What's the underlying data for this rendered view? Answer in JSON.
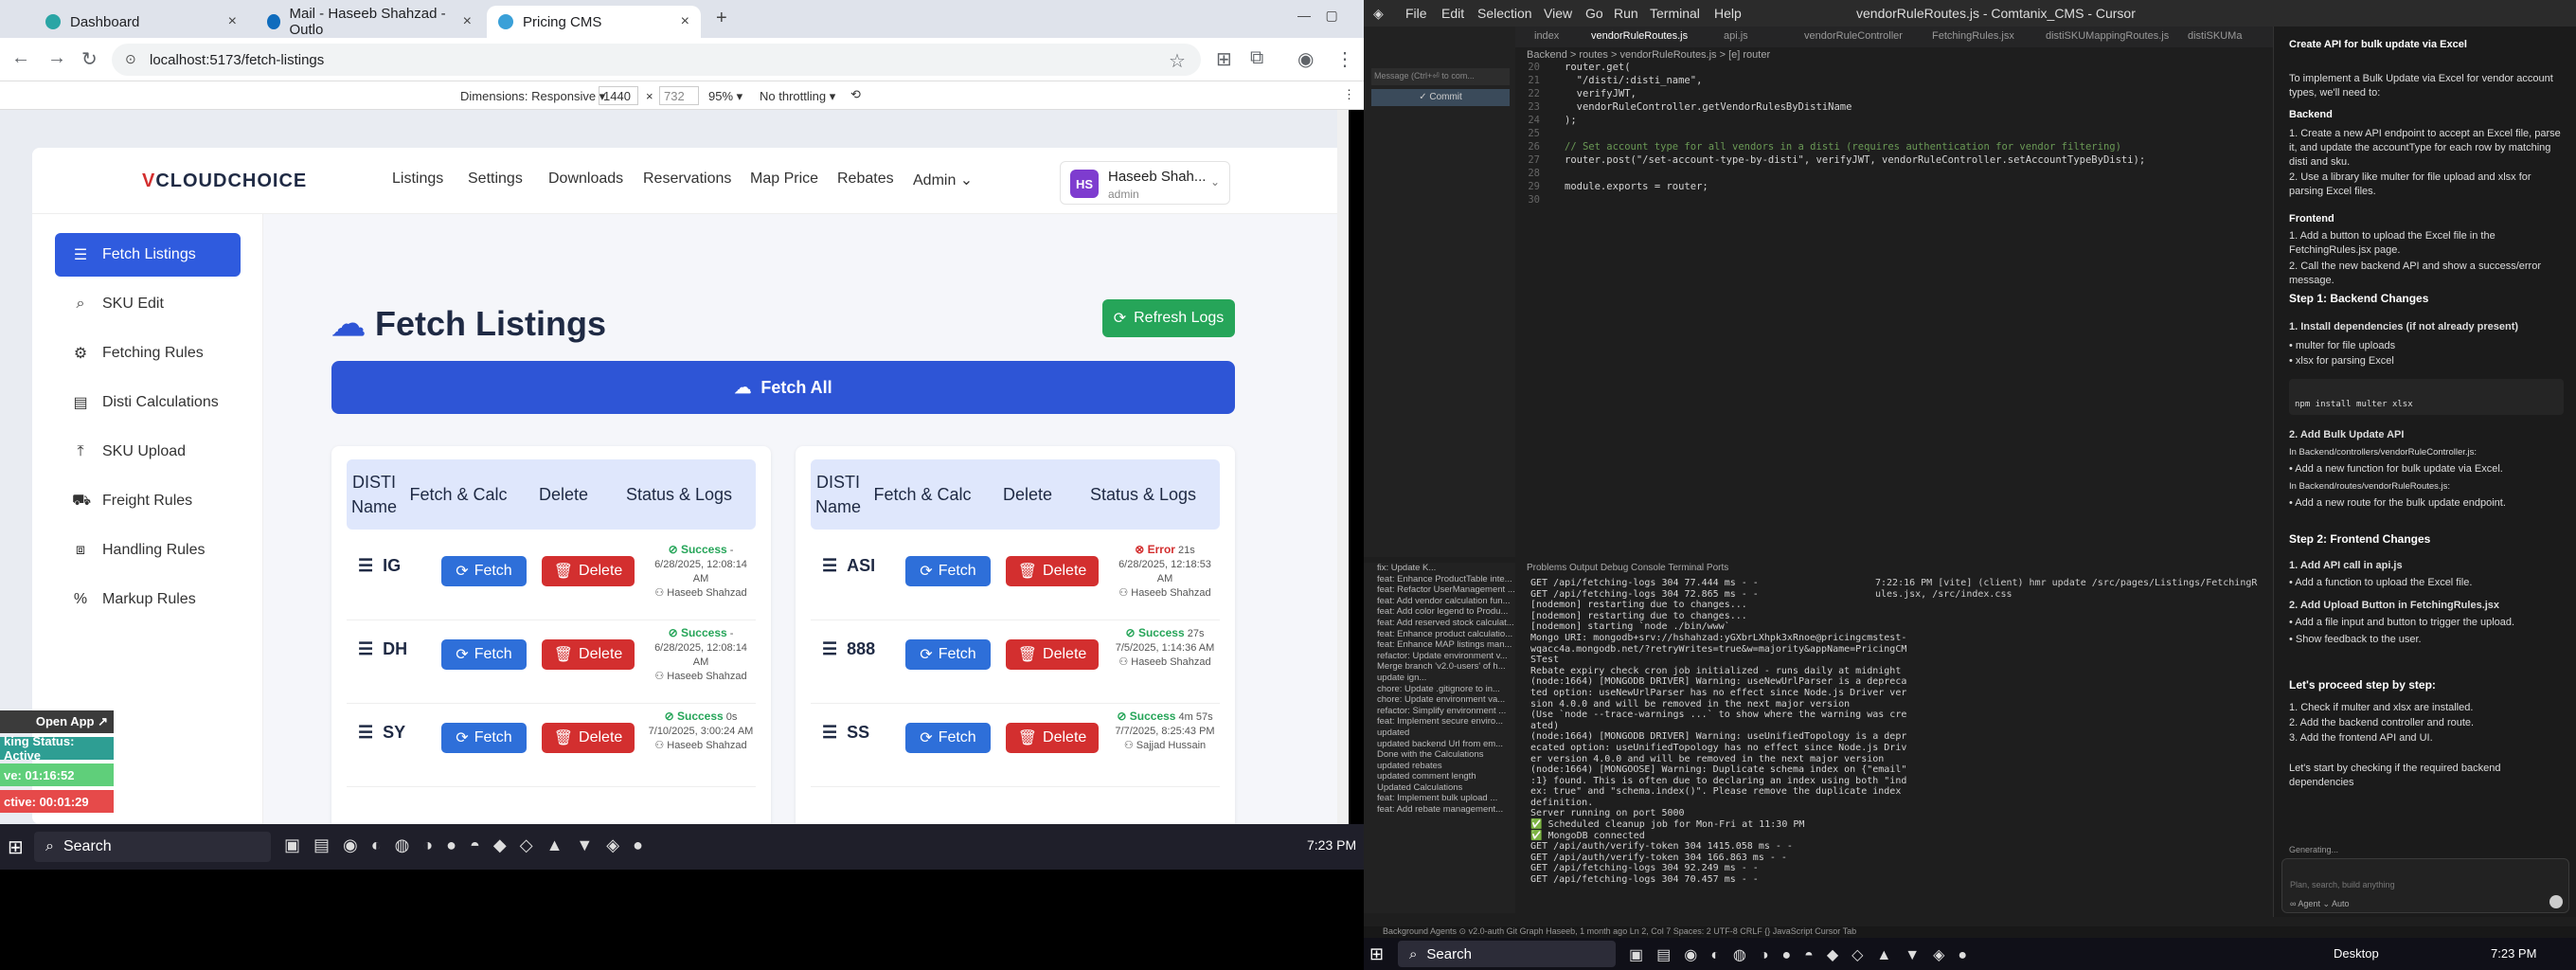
{
  "browser": {
    "tabs": [
      {
        "title": "Dashboard"
      },
      {
        "title": "Mail - Haseeb Shahzad - Outlo"
      },
      {
        "title": "Pricing CMS"
      }
    ],
    "new_tab": "+",
    "url": "localhost:5173/fetch-listings",
    "devtools": {
      "dimensions_label": "Dimensions: Responsive ▾",
      "width": "1440",
      "x": "×",
      "height": "732",
      "zoom": "95% ▾",
      "throttling": "No throttling ▾"
    }
  },
  "app": {
    "logo_v": "V",
    "logo_text": "CLOUDCHOICE",
    "nav": [
      "Listings",
      "Settings",
      "Downloads",
      "Reservations",
      "Map Price",
      "Rebates",
      "Admin ⌄"
    ],
    "user": {
      "initials": "HS",
      "name": "Haseeb Shah...",
      "role": "admin"
    },
    "sidebar": [
      "Fetch Listings",
      "SKU Edit",
      "Fetching Rules",
      "Disti Calculations",
      "SKU Upload",
      "Freight Rules",
      "Handling Rules",
      "Markup Rules"
    ],
    "page_title": "Fetch Listings",
    "refresh_label": "Refresh Logs",
    "fetch_all_label": "Fetch All",
    "table_headers": [
      "DISTI Name",
      "Fetch & Calc",
      "Delete",
      "Status & Logs"
    ],
    "fetch_label": "Fetch",
    "delete_label": "Delete",
    "left_rows": [
      {
        "name": "IG",
        "status": "Success",
        "time": "-",
        "date": "6/28/2025, 12:08:14 AM",
        "user": "Haseeb Shahzad",
        "ok": true
      },
      {
        "name": "DH",
        "status": "Success",
        "time": "-",
        "date": "6/28/2025, 12:08:14 AM",
        "user": "Haseeb Shahzad",
        "ok": true
      },
      {
        "name": "SY",
        "status": "Success",
        "time": "0s",
        "date": "7/10/2025, 3:00:24 AM",
        "user": "Haseeb Shahzad",
        "ok": true
      }
    ],
    "right_rows": [
      {
        "name": "ASI",
        "status": "Error",
        "time": "21s",
        "date": "6/28/2025, 12:18:53 AM",
        "user": "Haseeb Shahzad",
        "ok": false
      },
      {
        "name": "888",
        "status": "Success",
        "time": "27s",
        "date": "7/5/2025, 1:14:36 AM",
        "user": "Haseeb Shahzad",
        "ok": true
      },
      {
        "name": "SS",
        "status": "Success",
        "time": "4m 57s",
        "date": "7/7/2025, 8:25:43 PM",
        "user": "Sajjad Hussain",
        "ok": true
      }
    ]
  },
  "floater": {
    "open_app": "Open App ↗",
    "status": "king Status: Active",
    "time1": "ve: 01:16:52",
    "time2": "ctive: 00:01:29"
  },
  "taskbar_left": {
    "search": "Search",
    "clock": "7:23 PM"
  },
  "editor": {
    "menu": [
      "File",
      "Edit",
      "Selection",
      "View",
      "Go",
      "Run",
      "Terminal",
      "Help"
    ],
    "title": "vendorRuleRoutes.js - Comtanix_CMS - Cursor",
    "tabs": [
      "index",
      "vendorRuleRoutes.js",
      "api.js",
      "vendorRuleController",
      "FetchingRules.jsx",
      "distiSKUMappingRoutes.js",
      "distiSKUMa"
    ],
    "breadcrumb": "Backend > routes > vendorRuleRoutes.js > [e] router",
    "code": [
      {
        "n": "20",
        "t": "router.get("
      },
      {
        "n": "21",
        "t": "  \"/disti/:disti_name\","
      },
      {
        "n": "22",
        "t": "  verifyJWT,"
      },
      {
        "n": "23",
        "t": "  vendorRuleController.getVendorRulesByDistiName"
      },
      {
        "n": "24",
        "t": ");"
      },
      {
        "n": "25",
        "t": ""
      },
      {
        "n": "26",
        "t": "// Set account type for all vendors in a disti (requires authentication for vendor filtering)"
      },
      {
        "n": "27",
        "t": "router.post(\"/set-account-type-by-disti\", verifyJWT, vendorRuleController.setAccountTypeByDisti);"
      },
      {
        "n": "28",
        "t": ""
      },
      {
        "n": "29",
        "t": "module.exports = router;"
      },
      {
        "n": "30",
        "t": ""
      }
    ],
    "terminal_tabs": "Problems   Output   Debug Console   Terminal   Ports",
    "terminal_lines": [
      "GET /api/fetching-logs 304 77.444 ms - -",
      "GET /api/fetching-logs 304 72.865 ms - -",
      "[nodemon] restarting due to changes...",
      "[nodemon] restarting due to changes...",
      "[nodemon] starting `node ./bin/www`",
      "Mongo URI: mongodb+srv://hshahzad:yGXbrLXhpk3xRnoe@pricingcmstest-",
      "wqacc4a.mongodb.net/?retryWrites=true&w=majority&appName=PricingCM",
      "STest",
      "Rebate expiry check cron job initialized - runs daily at midnight",
      "(node:1664) [MONGODB DRIVER] Warning: useNewUrlParser is a depreca",
      "ted option: useNewUrlParser has no effect since Node.js Driver ver",
      "sion 4.0.0 and will be removed in the next major version",
      "(Use `node --trace-warnings ...` to show where the warning was cre",
      "ated)",
      "(node:1664) [MONGODB DRIVER] Warning: useUnifiedTopology is a depr",
      "ecated option: useUnifiedTopology has no effect since Node.js Driv",
      "er version 4.0.0 and will be removed in the next major version",
      "(node:1664) [MONGOOSE] Warning: Duplicate schema index on {\"email\"",
      ":1} found. This is often due to declaring an index using both \"ind",
      "ex: true\" and \"schema.index()\". Please remove the duplicate index",
      "definition.",
      "Server running on port 5000",
      "✅ Scheduled cleanup job for Mon-Fri at 11:30 PM",
      "✅ MongoDB connected",
      "GET /api/auth/verify-token 304 1415.058 ms - -",
      "GET /api/auth/verify-token 304 166.863 ms - -",
      "GET /api/fetching-logs 304 92.249 ms - -",
      "GET /api/fetching-logs 304 70.457 ms - -"
    ],
    "term2_lines": [
      "7:22:16 PM [vite] (client) hmr update /src/pages/Listings/FetchingR",
      "ules.jsx, /src/index.css"
    ],
    "git_list": [
      "fix: Update K...",
      "feat: Enhance ProductTable inte...",
      "feat: Refactor UserManagement ...",
      "feat: Add vendor calculation fun...",
      "feat: Add color legend to Produ...",
      "feat: Add reserved stock calculat...",
      "feat: Enhance product calculatio...",
      "feat: Enhance MAP listings man...",
      "refactor: Update environment v...",
      "Merge branch 'v2.0-users' of h...",
      "update ign...",
      "chore: Update .gitignore to in...",
      "chore: Update environment va...",
      "refactor: Simplify environment ...",
      "feat: Implement secure enviro...",
      "updated",
      "updated backend Url from em...",
      "Done with the Calculations",
      "updated rebates",
      "updated comment length",
      "Updated Calculations",
      "feat: Implement bulk upload ...",
      "feat: Add rebate management..."
    ],
    "chat": {
      "title": "Create API for bulk update via Excel",
      "intro": "To implement a Bulk Update via Excel for vendor account types, we'll need to:",
      "backend_h": "Backend",
      "backend_1": "1. Create a new API endpoint to accept an Excel file, parse it, and update the accountType for each row by matching disti and sku.",
      "backend_2": "2. Use a library like multer for file upload and xlsx for parsing Excel files.",
      "frontend_h": "Frontend",
      "frontend_1": "1. Add a button to upload the Excel file in the FetchingRules.jsx page.",
      "frontend_2": "2. Call the new backend API and show a success/error message.",
      "step1": "Step 1: Backend Changes",
      "step1_1": "1. Install dependencies (if not already present)",
      "multer": "• multer for file uploads",
      "xlsx": "• xlsx for parsing Excel",
      "cmd": "npm install multer xlsx",
      "step1_2": "2. Add Bulk Update API",
      "in_ctrl": "In Backend/controllers/vendorRuleController.js:",
      "ctrl_b": "• Add a new function for bulk update via Excel.",
      "in_routes": "In Backend/routes/vendorRuleRoutes.js:",
      "routes_b": "• Add a new route for the bulk update endpoint.",
      "step2": "Step 2: Frontend Changes",
      "step2_1": "1. Add API call in api.js",
      "step2_1b": "• Add a function to upload the Excel file.",
      "step2_2": "2. Add Upload Button in FetchingRules.jsx",
      "step2_2a": "• Add a file input and button to trigger the upload.",
      "step2_2b": "• Show feedback to the user.",
      "proceed": "Let's proceed step by step:",
      "p1": "1. Check if multer and xlsx are installed.",
      "p2": "2. Add the backend controller and route.",
      "p3": "3. Add the frontend API and UI.",
      "start": "Let's start by checking if the required backend dependencies",
      "generating": "Generating...",
      "input_placeholder": "Plan, search, build anything",
      "agent": "∞ Agent ⌄   Auto"
    },
    "status_bar": "Background Agents   ⊙ v2.0-auth   Git Graph   Haseeb, 1 month ago   Ln 2, Col 7   Spaces: 2   UTF-8   CRLF   {} JavaScript   Cursor Tab"
  },
  "taskbar_right": {
    "search": "Search",
    "desktop": "Desktop",
    "clock": "7:23 PM"
  }
}
